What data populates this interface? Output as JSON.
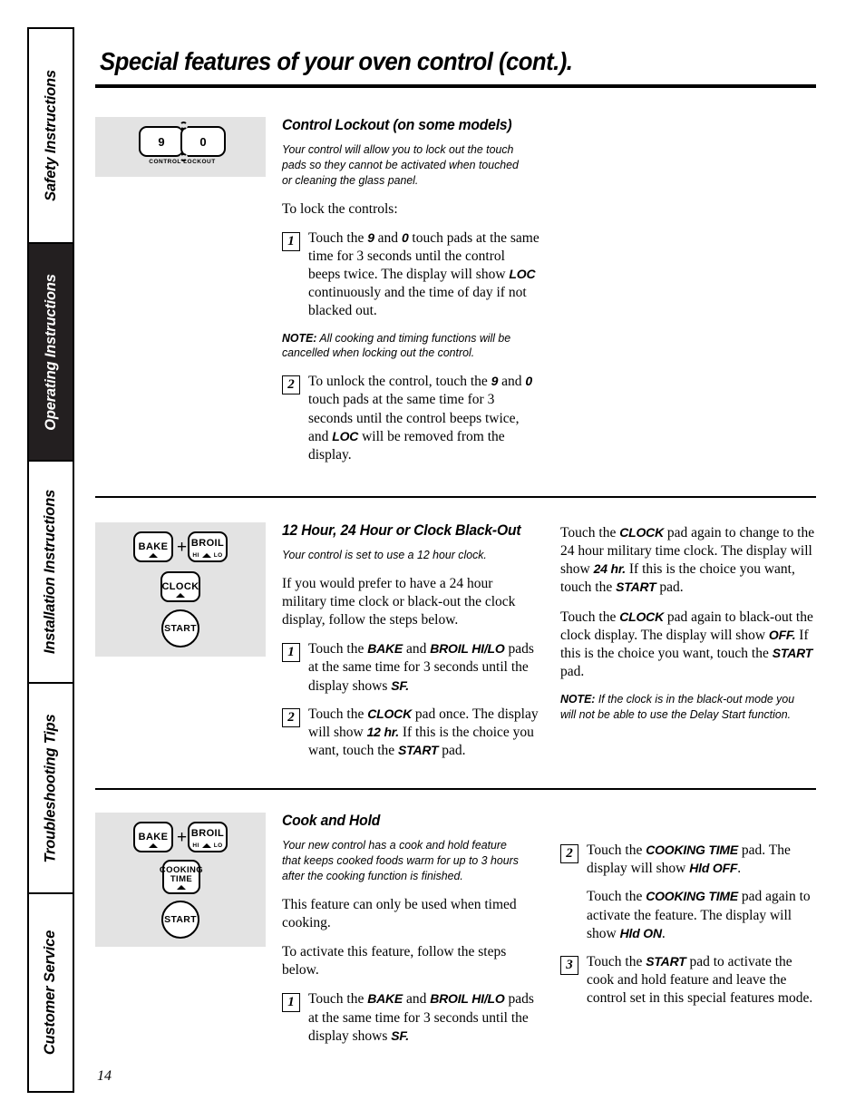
{
  "page": {
    "title": "Special features of your oven control (cont.).",
    "number": "14"
  },
  "sidebar": {
    "tabs": [
      {
        "label": "Safety Instructions",
        "active": false
      },
      {
        "label": "Operating Instructions",
        "active": true
      },
      {
        "label": "Installation Instructions",
        "active": false
      },
      {
        "label": "Troubleshooting Tips",
        "active": false
      },
      {
        "label": "Customer Service",
        "active": false
      }
    ]
  },
  "sections": [
    {
      "id": "control-lockout",
      "heading": "Control Lockout (on some models)",
      "graphic": {
        "type": "lockout-pads",
        "pads": [
          "9",
          "0"
        ],
        "caption": "CONTROL LOCKOUT"
      },
      "intro": "Your control will allow you to lock out the touch pads so they cannot be activated when touched or cleaning the glass panel.",
      "lead": "To lock the controls:",
      "step1_num": "1",
      "step1_text": "Touch the 9 and 0 touch pads at the same time for 3 seconds until the control beeps twice. The display will show LOC continuously and the time of day if not blacked out.",
      "note_label": "NOTE:",
      "note_text": " All cooking and timing functions will be cancelled when locking out the control.",
      "step2_num": "2",
      "step2_text": "To unlock the control, touch the 9 and 0 touch pads at the same time for 3 seconds until the control beeps twice, and LOC will be removed from the display."
    },
    {
      "id": "clock-blackout",
      "heading": "12 Hour, 24 Hour or Clock Black-Out",
      "graphic": {
        "type": "pad-stack",
        "pads": [
          "BAKE",
          "BROIL",
          "CLOCK",
          "START"
        ],
        "broil_sub_left": "HI",
        "broil_sub_right": "LO",
        "plus": "+"
      },
      "intro": "Your control is set to use a 12 hour clock.",
      "body": "If you would prefer to have a 24 hour military time clock or black-out the clock display, follow the steps below.",
      "step1_num": "1",
      "step1_text": "Touch the BAKE and BROIL HI/LO pads at the same time for 3 seconds until the display shows SF.",
      "step2_num": "2",
      "step2_text": "Touch the CLOCK pad once. The display will show 12 hr. If this is the choice you want, touch the START pad.",
      "right_p1": "Touch the CLOCK pad again to change to the 24 hour military time clock. The display will show 24 hr. If this is the choice you want, touch the START pad.",
      "right_p2": "Touch the CLOCK pad again to black-out the clock display. The display will show OFF. If this is the choice you want, touch the START pad.",
      "note_label": "NOTE:",
      "note_text": " If the clock is in the black-out mode you will not be able to use the Delay Start function."
    },
    {
      "id": "cook-and-hold",
      "heading": "Cook and Hold",
      "graphic": {
        "type": "pad-stack",
        "pads": [
          "BAKE",
          "BROIL",
          "COOKING TIME",
          "START"
        ],
        "broil_sub_left": "HI",
        "broil_sub_right": "LO",
        "plus": "+"
      },
      "intro": "Your new control has a cook and hold feature that keeps cooked foods warm for up to 3 hours after the cooking function is finished.",
      "body1": "This feature can only be used when timed cooking.",
      "body2": "To activate this feature, follow the steps below.",
      "step1_num": "1",
      "step1_text": "Touch the BAKE and BROIL HI/LO pads at the same time for 3 seconds until the display shows SF.",
      "step2_num": "2",
      "step2_text": "Touch the COOKING TIME pad. The display will show Hld OFF.",
      "step2_cont": "Touch the COOKING TIME pad again to activate the feature. The display will show Hld ON.",
      "step3_num": "3",
      "step3_text": "Touch the START pad to activate the cook and hold feature and leave the control set in this special features mode."
    }
  ],
  "colors": {
    "panel_background": "#e3e3e3",
    "active_tab_background": "#231f20",
    "ink": "#000000"
  }
}
